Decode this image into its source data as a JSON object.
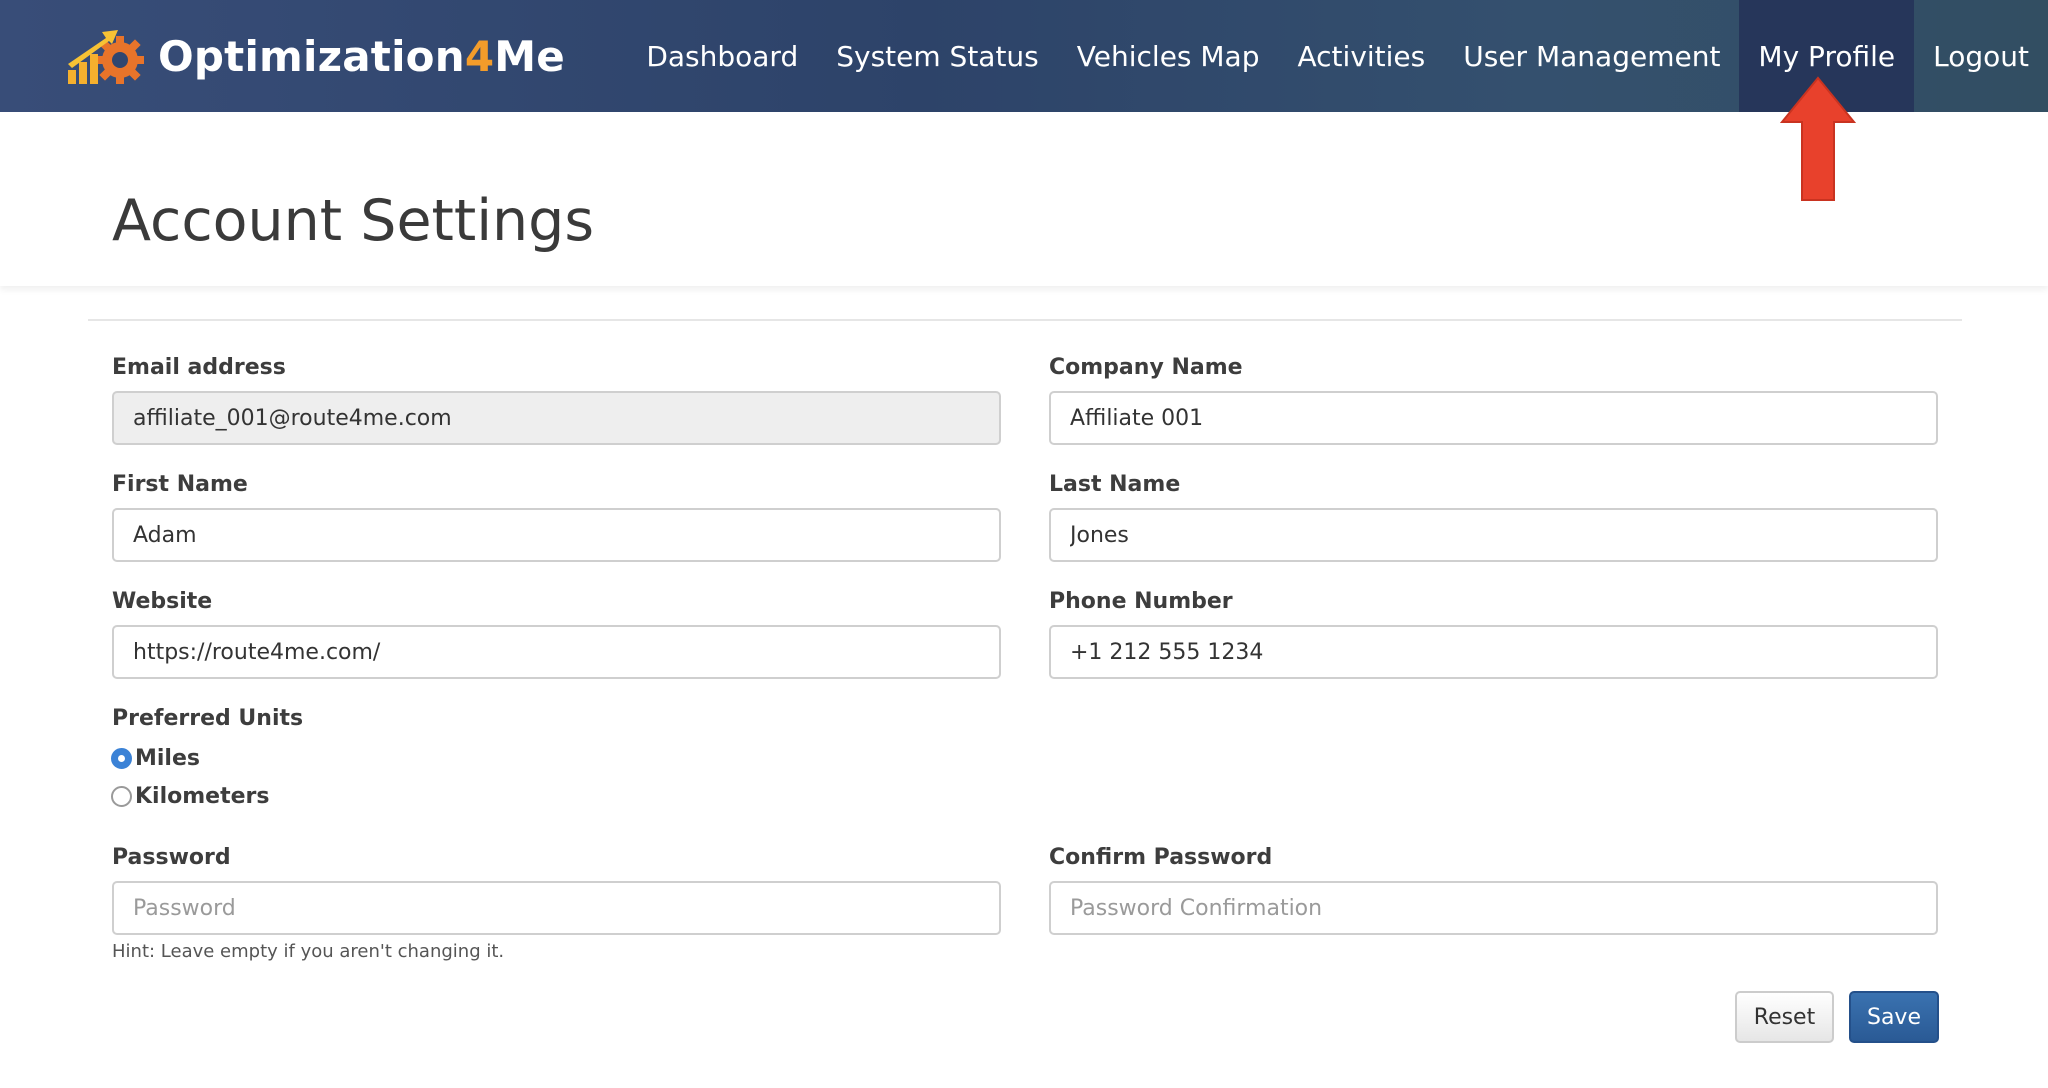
{
  "brand": {
    "name_prefix": "Optimization",
    "name_number": "4",
    "name_suffix": "Me",
    "colors": {
      "accent": "#f39c2a"
    }
  },
  "nav": {
    "items": [
      {
        "label": "Dashboard"
      },
      {
        "label": "System Status"
      },
      {
        "label": "Vehicles Map"
      },
      {
        "label": "Activities"
      },
      {
        "label": "User Management"
      },
      {
        "label": "My Profile",
        "active": true
      },
      {
        "label": "Logout"
      }
    ]
  },
  "page": {
    "title": "Account Settings"
  },
  "form": {
    "email": {
      "label": "Email address",
      "value": "affiliate_001@route4me.com"
    },
    "company": {
      "label": "Company Name",
      "value": "Affiliate 001"
    },
    "first_name": {
      "label": "First Name",
      "value": "Adam"
    },
    "last_name": {
      "label": "Last Name",
      "value": "Jones"
    },
    "website": {
      "label": "Website",
      "value": "https://route4me.com/"
    },
    "phone": {
      "label": "Phone Number",
      "value": "+1 212 555 1234"
    },
    "units": {
      "label": "Preferred Units",
      "options": [
        {
          "label": "Miles",
          "selected": true
        },
        {
          "label": "Kilometers",
          "selected": false
        }
      ]
    },
    "password": {
      "label": "Password",
      "placeholder": "Password"
    },
    "confirm_password": {
      "label": "Confirm Password",
      "placeholder": "Password Confirmation"
    },
    "hint": "Hint: Leave empty if you aren't changing it.",
    "buttons": {
      "reset": "Reset",
      "save": "Save"
    }
  },
  "annotation": {
    "icon": "red-arrow-up-icon",
    "color": "#e8412c"
  }
}
